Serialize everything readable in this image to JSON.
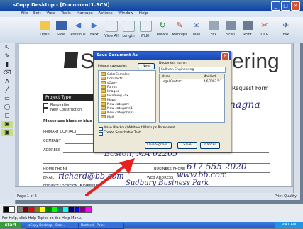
{
  "window": {
    "title": "sCopy Desktop - [Document1.SCN]",
    "menu": [
      "File",
      "Edit",
      "View",
      "Tools",
      "Markups",
      "Actions",
      "Window",
      "Help"
    ]
  },
  "toolbar": {
    "buttons": [
      {
        "label": "Open",
        "icon": "folder-icon"
      },
      {
        "label": "Save",
        "icon": "save-icon"
      },
      {
        "label": "Previous",
        "icon": "previous-icon"
      },
      {
        "label": "Next",
        "icon": "next-icon"
      },
      {
        "label": "View All",
        "icon": "view-all-icon"
      },
      {
        "label": "Length",
        "icon": "length-icon"
      },
      {
        "label": "Width",
        "icon": "width-icon"
      },
      {
        "label": "Rotate",
        "icon": "rotate-icon"
      },
      {
        "label": "Markups",
        "icon": "markups-icon"
      },
      {
        "label": "Mail",
        "icon": "mail-icon"
      },
      {
        "label": "Fax",
        "icon": "fax-icon"
      },
      {
        "label": "Scan",
        "icon": "scan-icon"
      },
      {
        "label": "Print",
        "icon": "print-icon"
      },
      {
        "label": "OCR",
        "icon": "ocr-icon"
      },
      {
        "label": "Fax",
        "icon": "fax2-icon"
      }
    ]
  },
  "document": {
    "brand_left": "Su",
    "brand_right": "ering",
    "subtitle": "Request Form",
    "project_type_label": "Project Type:",
    "checkbox_renovation": "Renovation",
    "checkbox_new_construction": "New Construction",
    "instructions": "Please use black or blue",
    "label_primary_contact": "PRIMARY CONTACT",
    "label_company": "COMPANY",
    "label_address": "ADDRESS",
    "label_home_phone": "HOME PHONE",
    "label_email": "EMAIL",
    "label_project_location": "PROJECT LOCATION IF DIFFERENT",
    "label_business_phone": "BUSINESS PHONE",
    "label_web_address": "WEB ADDRESS",
    "hand_city": "Boston, MA 02205",
    "hand_business_phone": "617-555-2020",
    "hand_email": "richard@bb.com",
    "hand_web": "www.bb.com",
    "hand_project": "Sudbury Business Park",
    "hand_topright": "nagna"
  },
  "status": {
    "page": "Page 1 of 5",
    "quality": "Print Quality"
  },
  "dialog": {
    "title": "Save Document As",
    "private_categories_label": "Private categories",
    "new_button": "New",
    "document_name_label": "Document name:",
    "document_name_value": "Sullivan Engineering",
    "col_name": "Name",
    "col_modified": "Modified",
    "file_name": "Legal Contract",
    "file_modified": "4/6/2003 5:1",
    "folders": [
      "ColorComplex",
      "Contracts",
      "sCopy",
      "Forms",
      "Images",
      "Incoming Fax",
      "Maps",
      "New category",
      "New category(1)",
      "New category(2)",
      "Mail"
    ],
    "checkbox_blackout": "Make Blackout/Whiteout Markups Permanent",
    "checkbox_searchable": "Create Searchable Text",
    "btn_save_signals": "Save Signals...",
    "btn_save": "Save",
    "btn_cancel": "Cancel"
  },
  "help_line": "For Help, click Help Topics on the Help Menu.",
  "taskbar": {
    "start": "start",
    "tasks": [
      "sCopy Desktop - Doc...",
      "Untitled - Paint"
    ],
    "clock": "9:41 AM"
  },
  "colors": {
    "accent": "#1a47b0",
    "arrow": "#e8201e"
  }
}
